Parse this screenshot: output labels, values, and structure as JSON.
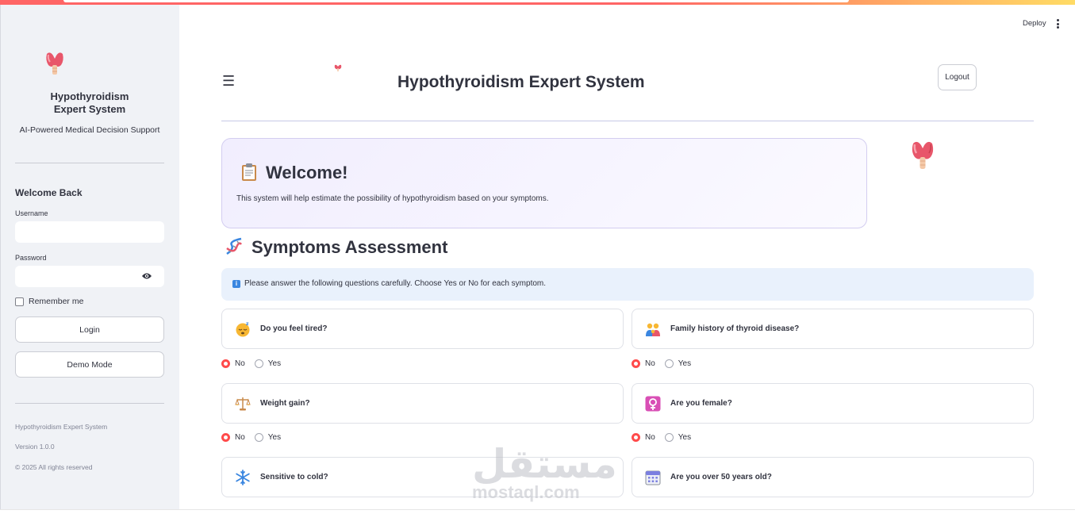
{
  "header": {
    "deploy_label": "Deploy",
    "page_title": "Hypothyroidism Expert System",
    "logout_label": "Logout"
  },
  "sidebar": {
    "title_line1": "Hypothyroidism",
    "title_line2": "Expert System",
    "subtitle": "AI-Powered Medical Decision Support",
    "welcome": "Welcome Back",
    "username_label": "Username",
    "username_value": "",
    "password_label": "Password",
    "password_value": "",
    "remember_label": "Remember me",
    "login_label": "Login",
    "demo_label": "Demo Mode",
    "footer_name": "Hypothyroidism Expert System",
    "footer_version": "Version 1.0.0",
    "footer_rights": "© 2025 All rights reserved"
  },
  "welcome_card": {
    "title": "Welcome!",
    "text": "This system will help estimate the possibility of hypothyroidism based on your symptoms."
  },
  "symptoms": {
    "title": "Symptoms Assessment",
    "info": "Please answer the following questions carefully. Choose Yes or No for each symptom.",
    "option_no": "No",
    "option_yes": "Yes",
    "questions": [
      {
        "label": "Do you feel tired?",
        "icon": "sleepy-face-icon",
        "selected": "No"
      },
      {
        "label": "Family history of thyroid disease?",
        "icon": "family-icon",
        "selected": "No"
      },
      {
        "label": "Weight gain?",
        "icon": "scales-icon",
        "selected": "No"
      },
      {
        "label": "Are you female?",
        "icon": "female-sign-icon",
        "selected": "No"
      },
      {
        "label": "Sensitive to cold?",
        "icon": "snowflake-icon",
        "selected": "No"
      },
      {
        "label": "Are you over 50 years old?",
        "icon": "calendar-icon",
        "selected": "No"
      }
    ]
  },
  "watermark": {
    "arabic": "مستقل",
    "latin": "mostaql.com"
  },
  "colors": {
    "accent": "#ff4b4b",
    "sidebar_bg": "#f0f2f6",
    "info_bg": "#e9f1fc",
    "welcome_border": "#d3cdf0"
  }
}
